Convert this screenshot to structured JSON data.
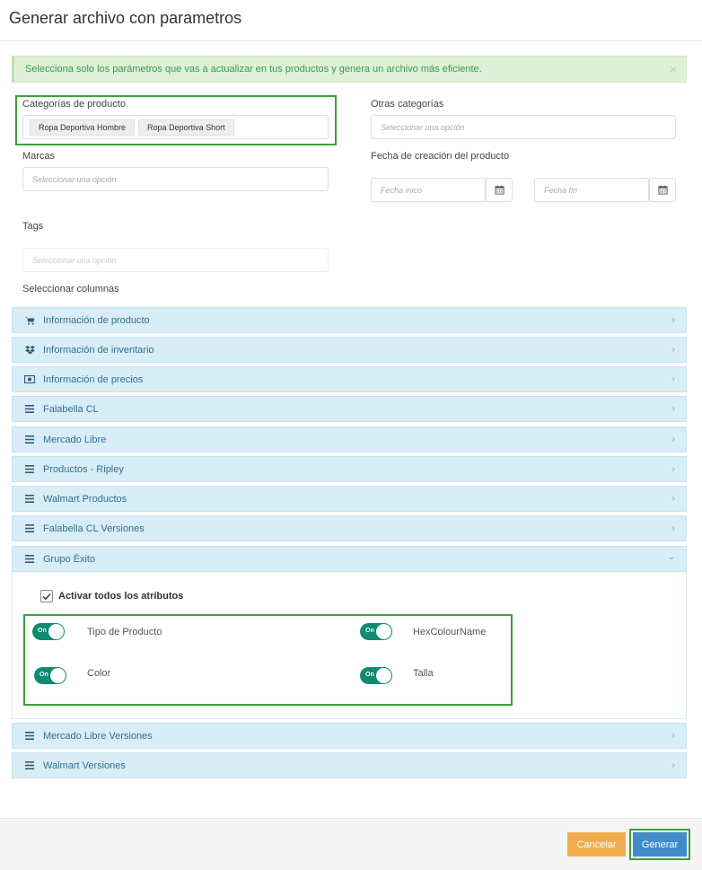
{
  "modal": {
    "title": "Generar archivo con parametros"
  },
  "alert": {
    "text": "Selecciona solo los parámetros que vas a actualizar en tus productos y genera un archivo más eficiente.",
    "close": "×"
  },
  "filters": {
    "categorias": {
      "label": "Categorías de producto",
      "tags": [
        "Ropa Deportiva Hombre",
        "Ropa Deportiva Short"
      ]
    },
    "otras": {
      "label": "Otras categorías",
      "placeholder": "Seleccionar una opción"
    },
    "marcas": {
      "label": "Marcas",
      "placeholder": "Seleccionar una opción"
    },
    "fecha": {
      "label": "Fecha de creación del producto",
      "inicio_placeholder": "Fecha inico",
      "fin_placeholder": "Fecha fin"
    },
    "tags": {
      "label": "Tags",
      "placeholder": "Seleccionar una opción"
    }
  },
  "columns": {
    "label": "Seleccionar columnas",
    "sections": [
      {
        "label": "Información de producto",
        "icon": "cart-icon",
        "expanded": false
      },
      {
        "label": "Información de inventario",
        "icon": "dropbox-icon",
        "expanded": false
      },
      {
        "label": "Información de precios",
        "icon": "money-icon",
        "expanded": false
      },
      {
        "label": "Falabella CL",
        "icon": "bars-icon",
        "expanded": false
      },
      {
        "label": "Mercado Libre",
        "icon": "bars-icon",
        "expanded": false
      },
      {
        "label": "Productos - Ripley",
        "icon": "bars-icon",
        "expanded": false
      },
      {
        "label": "Walmart Productos",
        "icon": "bars-icon",
        "expanded": false
      },
      {
        "label": "Falabella CL Versiones",
        "icon": "bars-icon",
        "expanded": false
      },
      {
        "label": "Grupo Éxito",
        "icon": "bars-icon",
        "expanded": true
      },
      {
        "label": "Mercado Libre Versiones",
        "icon": "bars-icon",
        "expanded": false
      },
      {
        "label": "Walmart Versiones",
        "icon": "bars-icon",
        "expanded": false
      }
    ],
    "grupo_exito": {
      "activar_todos": "Activar todos los atributos",
      "attributes": [
        {
          "label": "Tipo de Producto",
          "state": "On"
        },
        {
          "label": "HexColourName",
          "state": "On"
        },
        {
          "label": "Color",
          "state": "On"
        },
        {
          "label": "Talla",
          "state": "On"
        }
      ]
    }
  },
  "footer": {
    "cancel": "Cancelar",
    "generate": "Generar"
  }
}
